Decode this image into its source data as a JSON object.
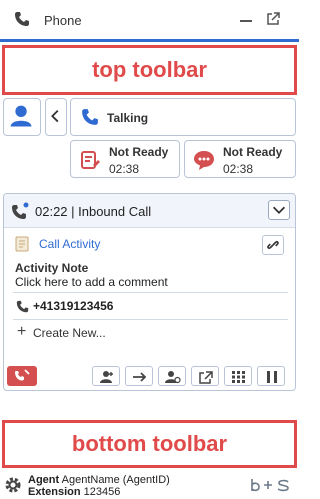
{
  "window": {
    "title": "Phone"
  },
  "top_toolbar_label": "top toolbar",
  "bottom_toolbar_label": "bottom toolbar",
  "session": {
    "talking_label": "Talking",
    "not_ready": [
      {
        "label": "Not Ready",
        "time": "02:38"
      },
      {
        "label": "Not Ready",
        "time": "02:38"
      }
    ]
  },
  "call": {
    "header": "02:22 | Inbound Call",
    "activity_label": "Call Activity",
    "note_title": "Activity Note",
    "note_hint": "Click here to add a comment",
    "number": "+41319123456",
    "create_new": "Create New..."
  },
  "status": {
    "agent_label": "Agent",
    "agent_name": "AgentName (AgentID)",
    "extension_label": "Extension",
    "extension": "123456",
    "logo": "b+s"
  },
  "colors": {
    "accent": "#2f6bd1",
    "red": "#d44f4f",
    "highlight": "#e04a4a"
  }
}
